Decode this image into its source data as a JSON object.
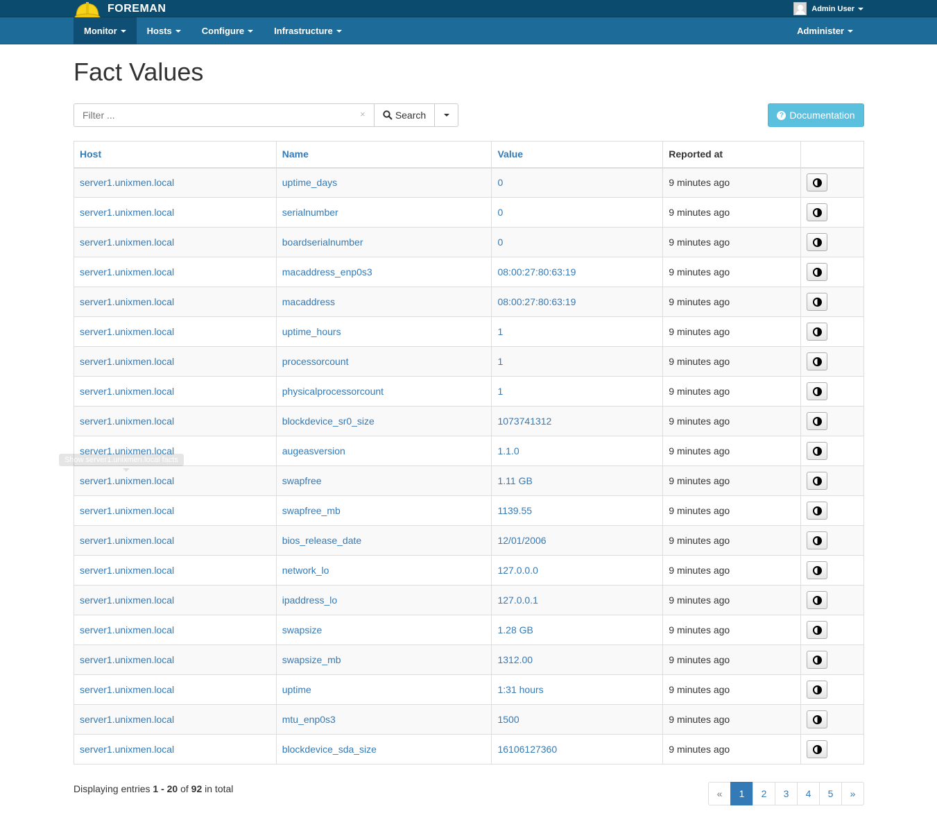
{
  "app": {
    "brand": "FOREMAN",
    "user": "Admin User"
  },
  "nav": {
    "items": [
      {
        "label": "Monitor",
        "active": true
      },
      {
        "label": "Hosts",
        "active": false
      },
      {
        "label": "Configure",
        "active": false
      },
      {
        "label": "Infrastructure",
        "active": false
      }
    ],
    "right": "Administer"
  },
  "page": {
    "title": "Fact Values"
  },
  "search": {
    "placeholder": "Filter ...",
    "clear": "×",
    "button": "Search"
  },
  "documentation": "Documentation",
  "table": {
    "headers": {
      "host": "Host",
      "name": "Name",
      "value": "Value",
      "reported": "Reported at"
    },
    "rows": [
      {
        "host": "server1.unixmen.local",
        "name": "uptime_days",
        "value": "0",
        "reported": "9 minutes ago"
      },
      {
        "host": "server1.unixmen.local",
        "name": "serialnumber",
        "value": "0",
        "reported": "9 minutes ago"
      },
      {
        "host": "server1.unixmen.local",
        "name": "boardserialnumber",
        "value": "0",
        "reported": "9 minutes ago"
      },
      {
        "host": "server1.unixmen.local",
        "name": "macaddress_enp0s3",
        "value": "08:00:27:80:63:19",
        "reported": "9 minutes ago"
      },
      {
        "host": "server1.unixmen.local",
        "name": "macaddress",
        "value": "08:00:27:80:63:19",
        "reported": "9 minutes ago"
      },
      {
        "host": "server1.unixmen.local",
        "name": "uptime_hours",
        "value": "1",
        "reported": "9 minutes ago"
      },
      {
        "host": "server1.unixmen.local",
        "name": "processorcount",
        "value": "1",
        "reported": "9 minutes ago"
      },
      {
        "host": "server1.unixmen.local",
        "name": "physicalprocessorcount",
        "value": "1",
        "reported": "9 minutes ago"
      },
      {
        "host": "server1.unixmen.local",
        "name": "blockdevice_sr0_size",
        "value": "1073741312",
        "reported": "9 minutes ago"
      },
      {
        "host": "server1.unixmen.local",
        "name": "augeasversion",
        "value": "1.1.0",
        "reported": "9 minutes ago"
      },
      {
        "host": "server1.unixmen.local",
        "name": "swapfree",
        "value": "1.11 GB",
        "reported": "9 minutes ago"
      },
      {
        "host": "server1.unixmen.local",
        "name": "swapfree_mb",
        "value": "1139.55",
        "reported": "9 minutes ago"
      },
      {
        "host": "server1.unixmen.local",
        "name": "bios_release_date",
        "value": "12/01/2006",
        "reported": "9 minutes ago"
      },
      {
        "host": "server1.unixmen.local",
        "name": "network_lo",
        "value": "127.0.0.0",
        "reported": "9 minutes ago"
      },
      {
        "host": "server1.unixmen.local",
        "name": "ipaddress_lo",
        "value": "127.0.0.1",
        "reported": "9 minutes ago"
      },
      {
        "host": "server1.unixmen.local",
        "name": "swapsize",
        "value": "1.28 GB",
        "reported": "9 minutes ago"
      },
      {
        "host": "server1.unixmen.local",
        "name": "swapsize_mb",
        "value": "1312.00",
        "reported": "9 minutes ago"
      },
      {
        "host": "server1.unixmen.local",
        "name": "uptime",
        "value": "1:31 hours",
        "reported": "9 minutes ago"
      },
      {
        "host": "server1.unixmen.local",
        "name": "mtu_enp0s3",
        "value": "1500",
        "reported": "9 minutes ago"
      },
      {
        "host": "server1.unixmen.local",
        "name": "blockdevice_sda_size",
        "value": "16106127360",
        "reported": "9 minutes ago"
      }
    ]
  },
  "tooltip": "Show server1.unixmen.local facts",
  "footer": {
    "prefix": "Displaying entries ",
    "range": "1 - 20",
    "of": " of ",
    "total": "92",
    "suffix": " in total"
  },
  "pagination": {
    "prev": "«",
    "pages": [
      "1",
      "2",
      "3",
      "4",
      "5"
    ],
    "next": "»",
    "current": "1"
  },
  "colors": {
    "topbar": "#0b4c6e",
    "navbar": "#1d6b99",
    "link": "#337ab7",
    "info_button": "#5bc0de"
  },
  "icons": {
    "brand": "helmet-icon",
    "user": "avatar",
    "search": "search-icon",
    "documentation": "question-circle-icon",
    "row_action": "half-circle-chart-icon"
  }
}
